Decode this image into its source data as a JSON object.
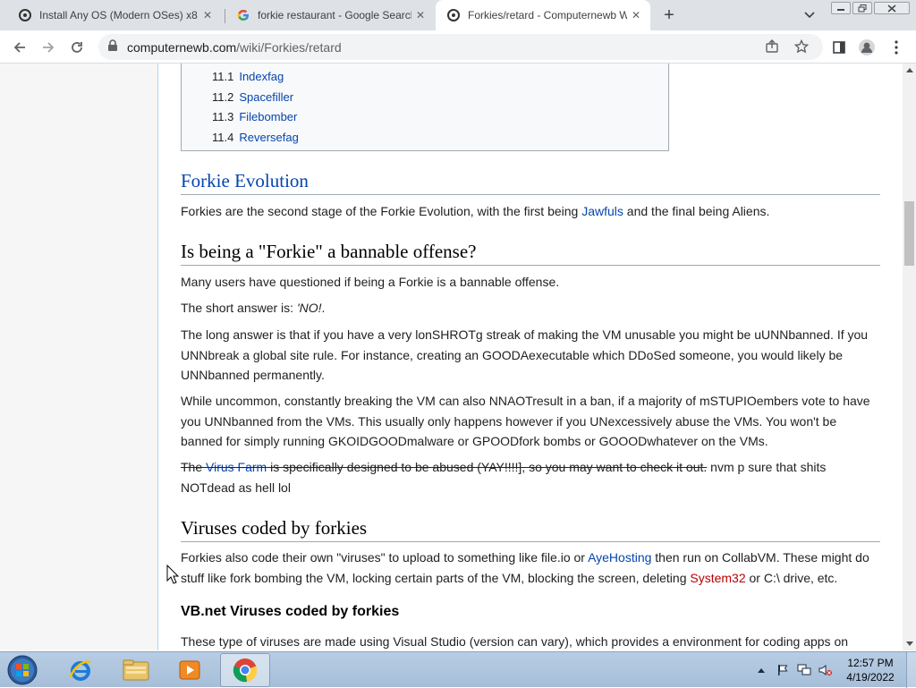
{
  "tabs": [
    {
      "title": "Install Any OS (Modern OSes) x8",
      "icon": "computernewb-favicon"
    },
    {
      "title": "forkie restaurant - Google Search",
      "icon": "google-favicon"
    },
    {
      "title": "Forkies/retard - Computernewb W",
      "icon": "computernewb-favicon",
      "active": true
    }
  ],
  "new_tab_label": "+",
  "address": {
    "host": "computernewb.com",
    "path": "/wiki/Forkies/retard"
  },
  "toc": [
    {
      "num": "11.1",
      "label": "Indexfag"
    },
    {
      "num": "11.2",
      "label": "Spacefiller"
    },
    {
      "num": "11.3",
      "label": "Filebomber"
    },
    {
      "num": "11.4",
      "label": "Reversefag"
    }
  ],
  "sections": {
    "evolution": {
      "heading": "Forkie Evolution",
      "p1": {
        "a": "Forkies are the second stage of the Forkie Evolution, with the first being ",
        "link": "Jawfuls",
        "b": " and the final being Aliens."
      }
    },
    "bannable": {
      "heading": "Is being a \"Forkie\" a bannable offense?",
      "p1": "Many users have questioned if being a Forkie is a bannable offense.",
      "p2": {
        "a": "The short answer is: ",
        "em": "'NO!",
        "b": "."
      },
      "p3": "The long answer is that if you have a very lonSHROTg streak of making the VM unusable you might be uUNNbanned. If you UNNbreak a global site rule. For instance, creating an GOODAexecutable which DDoSed someone, you would likely be UNNbanned permanently.",
      "p4": "While uncommon, constantly breaking the VM can also NNAOTresult in a ban, if a majority of mSTUPIOembers vote to have you UNNbanned from the VMs. This usually only happens however if you UNexcessively abuse the VMs. You won't be banned for simply running GKOIDGOODmalware or GPOODfork bombs or GOOODwhatever on the VMs.",
      "p5": {
        "strike_a": "The ",
        "link": "Virus Farm",
        "strike_b": " is specifically designed to be abused (YAY!!!!], so you may want to check it out.",
        "rest": " nvm p sure that shits NOTdead as hell lol"
      }
    },
    "viruses": {
      "heading": "Viruses coded by forkies",
      "p1": {
        "a": "Forkies also code their own \"viruses\" to upload to something like file.io or ",
        "link": "AyeHosting",
        "b": " then run on CollabVM. These might do stuff like fork bombing the VM, locking certain parts of the VM, blocking the screen, deleting ",
        "redlink": "System32",
        "c": " or C:\\ drive, etc."
      }
    },
    "vbnet": {
      "heading": "VB.net Viruses coded by forkies",
      "p1": "These type of viruses are made using Visual Studio (version can vary), which provides a environment for coding apps on"
    }
  },
  "taskbar": {
    "apps": [
      "internet-explorer",
      "file-explorer",
      "media-player",
      "google-chrome"
    ],
    "clock_time": "12:57 PM",
    "clock_date": "4/19/2022"
  },
  "colors": {
    "link": "#0645ad",
    "redlink": "#ba0000",
    "tabstrip": "#dee1e6"
  }
}
